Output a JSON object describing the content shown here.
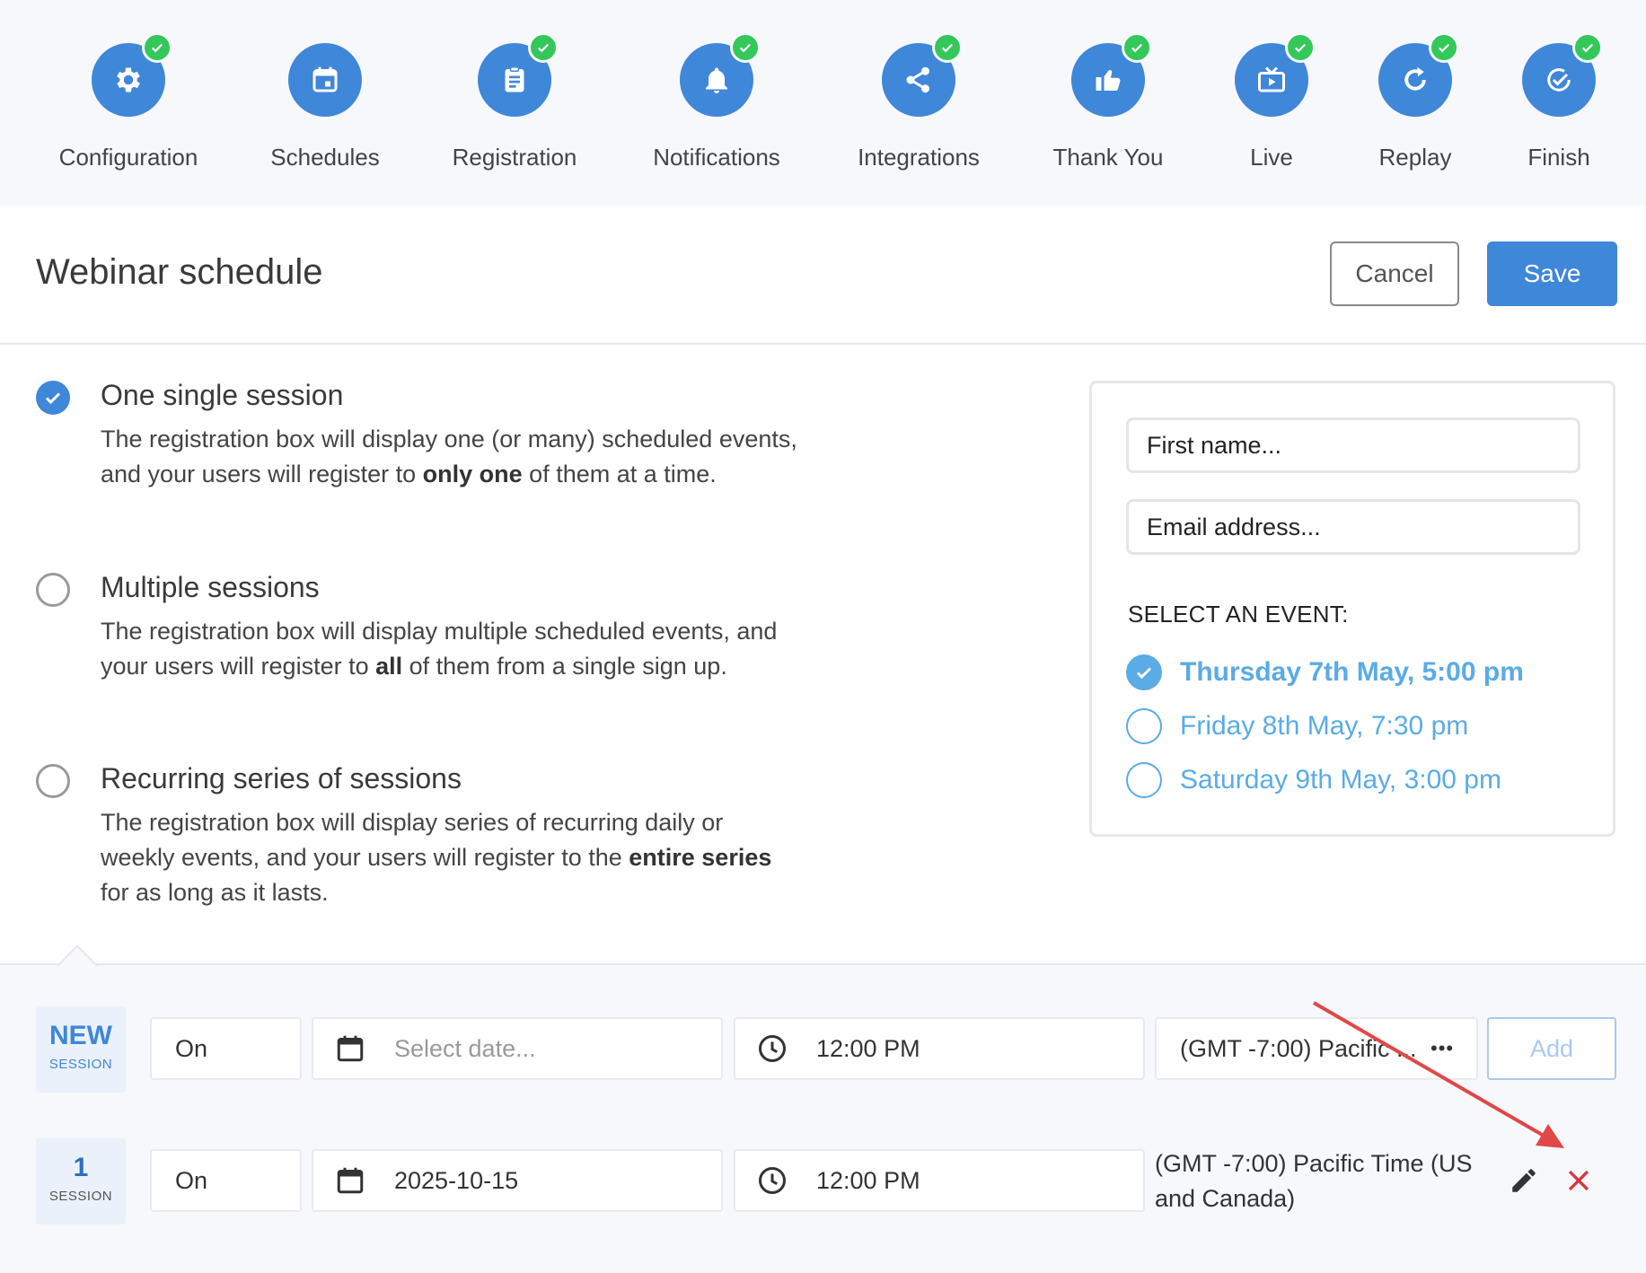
{
  "steps": [
    {
      "label": "Configuration",
      "icon": "gear-icon",
      "done": true
    },
    {
      "label": "Schedules",
      "icon": "calendar-icon",
      "done": false
    },
    {
      "label": "Registration",
      "icon": "clipboard-icon",
      "done": true
    },
    {
      "label": "Notifications",
      "icon": "bell-icon",
      "done": true
    },
    {
      "label": "Integrations",
      "icon": "share-icon",
      "done": true
    },
    {
      "label": "Thank You",
      "icon": "thumbs-up-icon",
      "done": true
    },
    {
      "label": "Live",
      "icon": "tv-play-icon",
      "done": true
    },
    {
      "label": "Replay",
      "icon": "replay-icon",
      "done": true
    },
    {
      "label": "Finish",
      "icon": "check-circle-icon",
      "done": true
    }
  ],
  "header": {
    "title": "Webinar schedule",
    "cancel_label": "Cancel",
    "save_label": "Save"
  },
  "options": [
    {
      "title": "One single session",
      "checked": true,
      "desc_before": "The registration box will display one (or many) scheduled events, and your users will register to ",
      "desc_bold": "only one",
      "desc_after": " of them at a time."
    },
    {
      "title": "Multiple sessions",
      "checked": false,
      "desc_before": "The registration box will display multiple scheduled events, and your users will register to ",
      "desc_bold": "all",
      "desc_after": " of them from a single sign up."
    },
    {
      "title": "Recurring series of sessions",
      "checked": false,
      "desc_before": "The registration box will display series of recurring daily or weekly events, and your users will register to the ",
      "desc_bold": "entire series",
      "desc_after": " for as long as it lasts."
    }
  ],
  "preview": {
    "first_name": "First name...",
    "email": "Email address...",
    "select_label": "SELECT AN EVENT:",
    "events": [
      {
        "label": "Thursday 7th May, 5:00 pm",
        "checked": true
      },
      {
        "label": "Friday 8th May, 7:30 pm",
        "checked": false
      },
      {
        "label": "Saturday 9th May, 3:00 pm",
        "checked": false
      }
    ]
  },
  "new_session": {
    "badge_top": "NEW",
    "badge_bottom": "SESSION",
    "mode": "On",
    "date_placeholder": "Select date...",
    "time": "12:00 PM",
    "timezone": "(GMT -7:00) Pacific ...",
    "more": "•••",
    "add_label": "Add"
  },
  "session_1": {
    "badge_top": "1",
    "badge_bottom": "SESSION",
    "mode": "On",
    "date": "2025-10-15",
    "time": "12:00 PM",
    "timezone": "(GMT -7:00) Pacific Time (US and Canada)"
  },
  "colors": {
    "accent": "#3f87d9",
    "done": "#34c759",
    "event": "#5aabe6",
    "delete": "#d9363e",
    "annotation_arrow": "#e04848"
  }
}
